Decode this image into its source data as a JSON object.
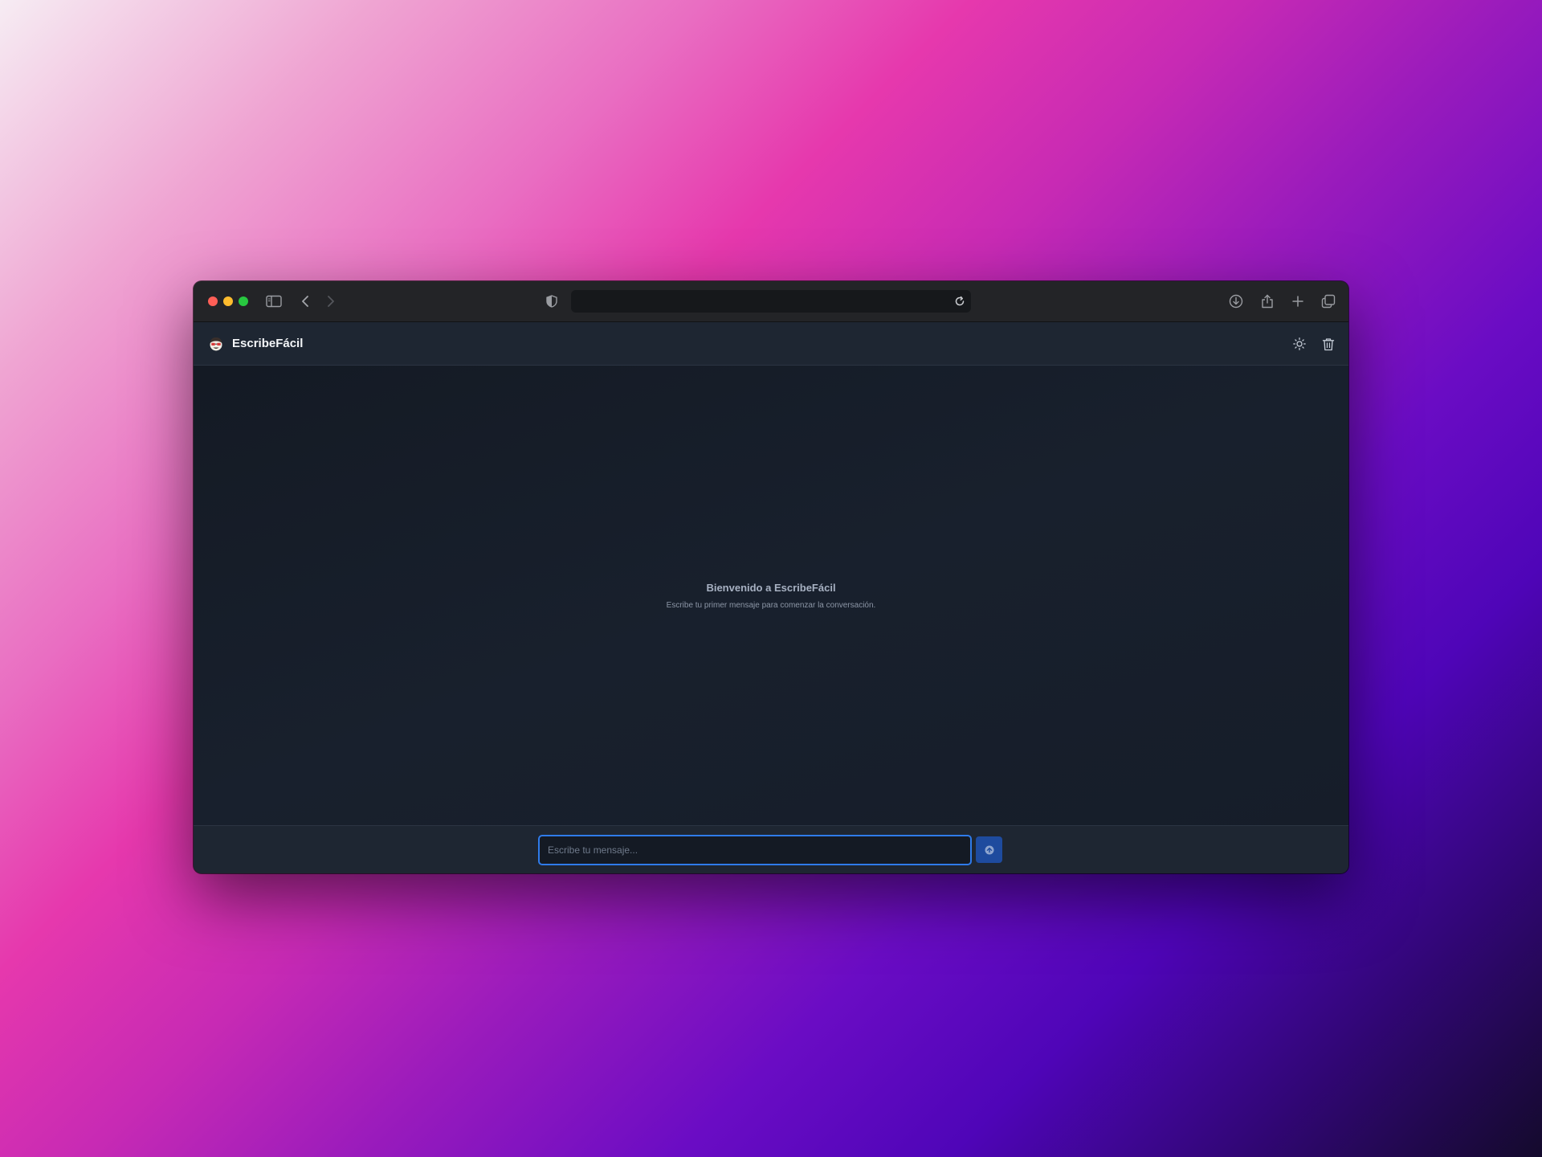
{
  "browser": {
    "address_value": "",
    "icons": {
      "sidebar": "sidebar-icon",
      "back": "chevron-left-icon",
      "forward": "chevron-right-icon",
      "privacy": "shield-icon",
      "reload": "reload-icon",
      "download": "download-icon",
      "share": "share-icon",
      "new_tab": "plus-icon",
      "tabs": "tabs-overview-icon"
    }
  },
  "app": {
    "name": "EscribeFácil",
    "logo_icon": "mascot-logo-icon",
    "theme_toggle_icon": "sun-icon",
    "clear_icon": "trash-icon"
  },
  "welcome": {
    "title": "Bienvenido a EscribeFácil",
    "subtitle": "Escribe tu primer mensaje para comenzar la conversación."
  },
  "composer": {
    "placeholder": "Escribe tu mensaje...",
    "value": "",
    "send_icon": "send-arrow-icon"
  },
  "colors": {
    "accent": "#2f7bea",
    "send_button": "#1e4b9e",
    "header_bg": "#1e2632",
    "chat_bg": "#161d29"
  }
}
